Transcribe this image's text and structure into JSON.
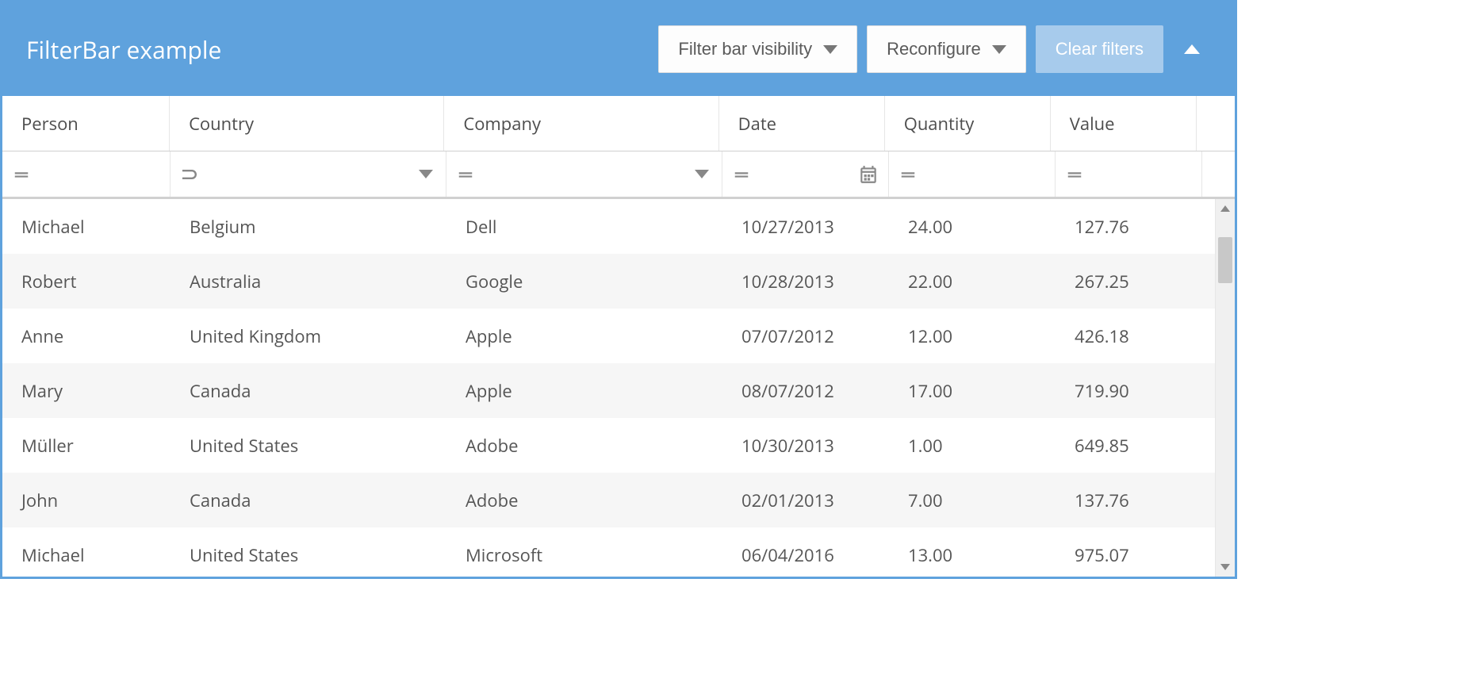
{
  "header": {
    "title": "FilterBar example",
    "filter_visibility_label": "Filter bar visibility",
    "reconfigure_label": "Reconfigure",
    "clear_filters_label": "Clear filters"
  },
  "columns": [
    {
      "key": "person",
      "label": "Person",
      "filter_op": "equals",
      "trigger": null
    },
    {
      "key": "country",
      "label": "Country",
      "filter_op": "contains",
      "trigger": "dropdown"
    },
    {
      "key": "company",
      "label": "Company",
      "filter_op": "equals",
      "trigger": "dropdown"
    },
    {
      "key": "date",
      "label": "Date",
      "filter_op": "equals",
      "trigger": "calendar"
    },
    {
      "key": "quantity",
      "label": "Quantity",
      "filter_op": "equals",
      "trigger": null
    },
    {
      "key": "value",
      "label": "Value",
      "filter_op": "equals",
      "trigger": null
    }
  ],
  "rows": [
    {
      "person": "Michael",
      "country": "Belgium",
      "company": "Dell",
      "date": "10/27/2013",
      "quantity": "24.00",
      "value": "127.76"
    },
    {
      "person": "Robert",
      "country": "Australia",
      "company": "Google",
      "date": "10/28/2013",
      "quantity": "22.00",
      "value": "267.25"
    },
    {
      "person": "Anne",
      "country": "United Kingdom",
      "company": "Apple",
      "date": "07/07/2012",
      "quantity": "12.00",
      "value": "426.18"
    },
    {
      "person": "Mary",
      "country": "Canada",
      "company": "Apple",
      "date": "08/07/2012",
      "quantity": "17.00",
      "value": "719.90"
    },
    {
      "person": "Müller",
      "country": "United States",
      "company": "Adobe",
      "date": "10/30/2013",
      "quantity": "1.00",
      "value": "649.85"
    },
    {
      "person": "John",
      "country": "Canada",
      "company": "Adobe",
      "date": "02/01/2013",
      "quantity": "7.00",
      "value": "137.76"
    },
    {
      "person": "Michael",
      "country": "United States",
      "company": "Microsoft",
      "date": "06/04/2016",
      "quantity": "13.00",
      "value": "975.07"
    }
  ]
}
